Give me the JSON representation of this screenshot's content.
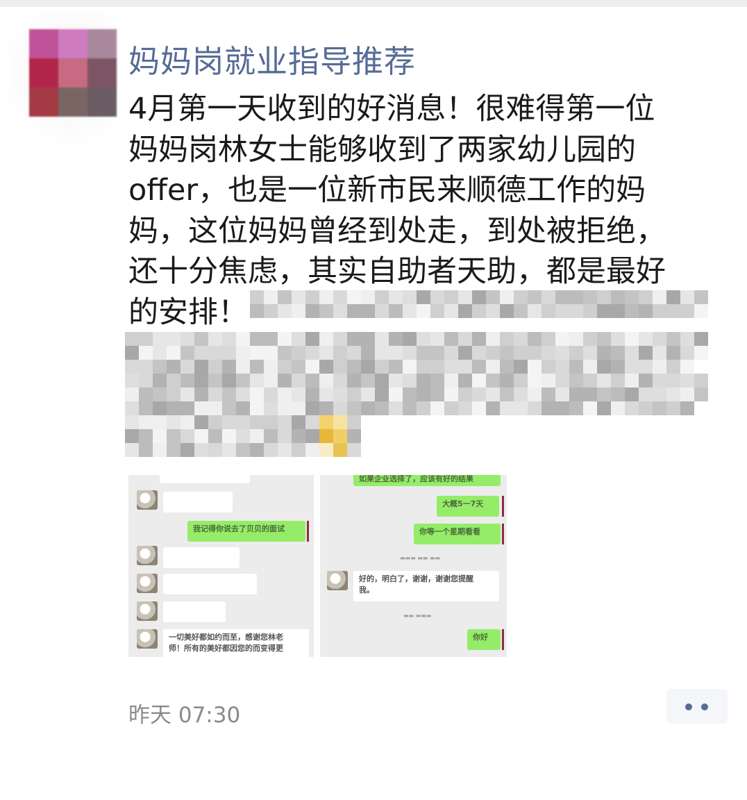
{
  "author": {
    "name": "妈妈岗就业指导推荐",
    "avatar_icon": "avatar-mosaic"
  },
  "post": {
    "lines": [
      "4月第一天收到的好消息！很难得第一位",
      "妈妈岗林女士能够收到了两家幼儿园的",
      "offer，也是一位新市民来顺德工作的妈",
      "妈，这位妈妈曾经到处走，到处被拒绝，",
      "还十分焦虑，其实自助者天助，都是最好",
      "的安排！"
    ]
  },
  "screenshots": {
    "left": {
      "bubbles": [
        "我记得你说去了贝贝的面试",
        "一切美好都如约而至，感谢您林老",
        "师！所有的美好都因您的而变得更"
      ]
    },
    "right": {
      "bubbles": [
        "如果企业选择了，应该有好的结果",
        "大概5一7天",
        "你等一个星期看看",
        "好的，明白了，谢谢，谢谢您提醒",
        "我。",
        "你好"
      ]
    }
  },
  "footer": {
    "time": "昨天 07:30",
    "more_icon": "more-dots-icon"
  },
  "colors": {
    "name_link": "#576b95",
    "chat_green": "#95ec69",
    "chat_bg": "#ececec"
  }
}
